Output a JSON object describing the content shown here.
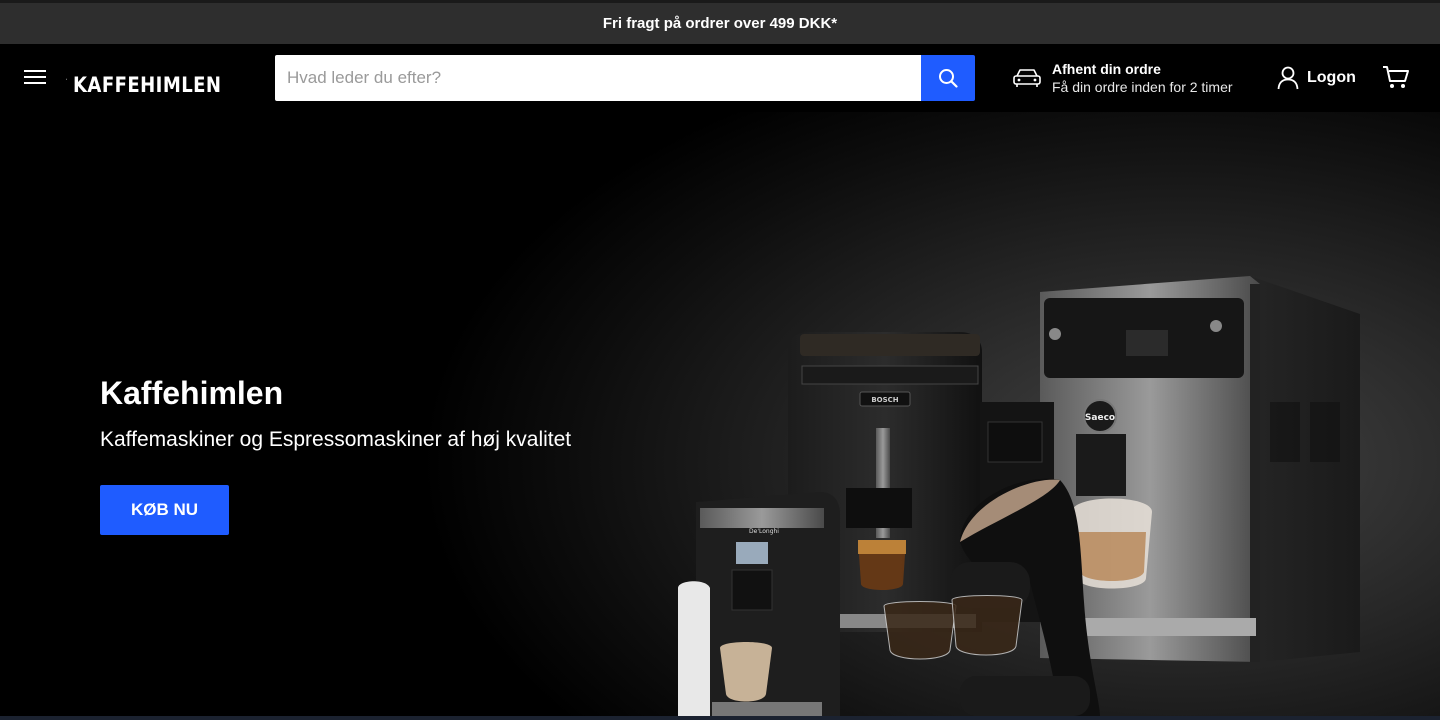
{
  "announcement": {
    "text": "Fri fragt på ordrer over 499 DKK*"
  },
  "header": {
    "menu_icon": "hamburger-menu-icon",
    "logo_text": "KAFFEHIMLEN",
    "search": {
      "placeholder": "Hvad leder du efter?",
      "value": "",
      "button_icon": "search-icon"
    },
    "pickup": {
      "icon": "car-icon",
      "title": "Afhent din ordre",
      "subtitle": "Få din ordre inden for 2 timer"
    },
    "login": {
      "icon": "user-icon",
      "label": "Logon"
    },
    "cart": {
      "icon": "cart-icon"
    }
  },
  "hero": {
    "title": "Kaffehimlen",
    "subtitle": "Kaffemaskiner og Espressomaskiner af høj kvalitet",
    "cta_label": "KØB NU",
    "image_label": "Espresso machines",
    "machine_brands": {
      "bosch": "BOSCH",
      "saeco": "Saeco",
      "delonghi": "De'Longhi"
    }
  },
  "colors": {
    "accent": "#1f5cff",
    "announcement_bg": "#2e2e2e",
    "header_bg": "#000000"
  }
}
